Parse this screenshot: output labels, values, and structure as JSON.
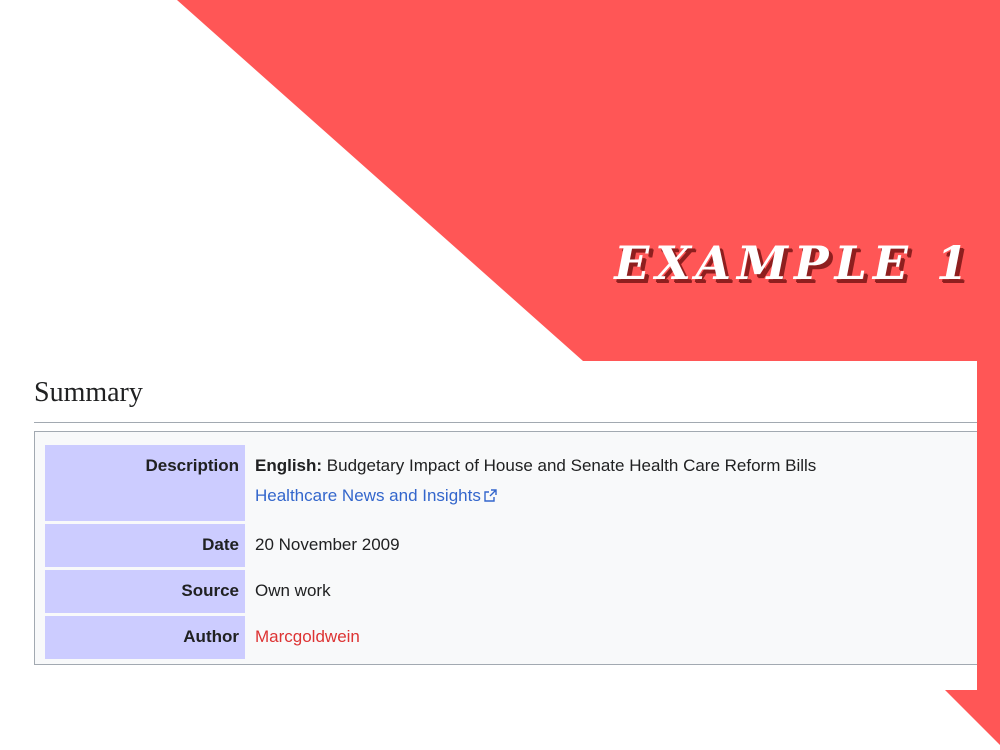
{
  "banner": {
    "title": "EXAMPLE 1",
    "accent_color": "#ff5656"
  },
  "summary": {
    "heading": "Summary",
    "rows": [
      {
        "label": "Description",
        "lang_label": "English:",
        "text": "Budgetary Impact of House and Senate Health Care Reform Bills",
        "link_text": "Healthcare News and Insights",
        "link_icon": "external-link-icon"
      },
      {
        "label": "Date",
        "value": "20 November 2009"
      },
      {
        "label": "Source",
        "value": "Own work"
      },
      {
        "label": "Author",
        "value": "Marcgoldwein"
      }
    ]
  },
  "colors": {
    "label_background": "#ccccff",
    "link": "#3366cc",
    "redlink": "#dd3333",
    "box_background": "#f8f9fa"
  }
}
